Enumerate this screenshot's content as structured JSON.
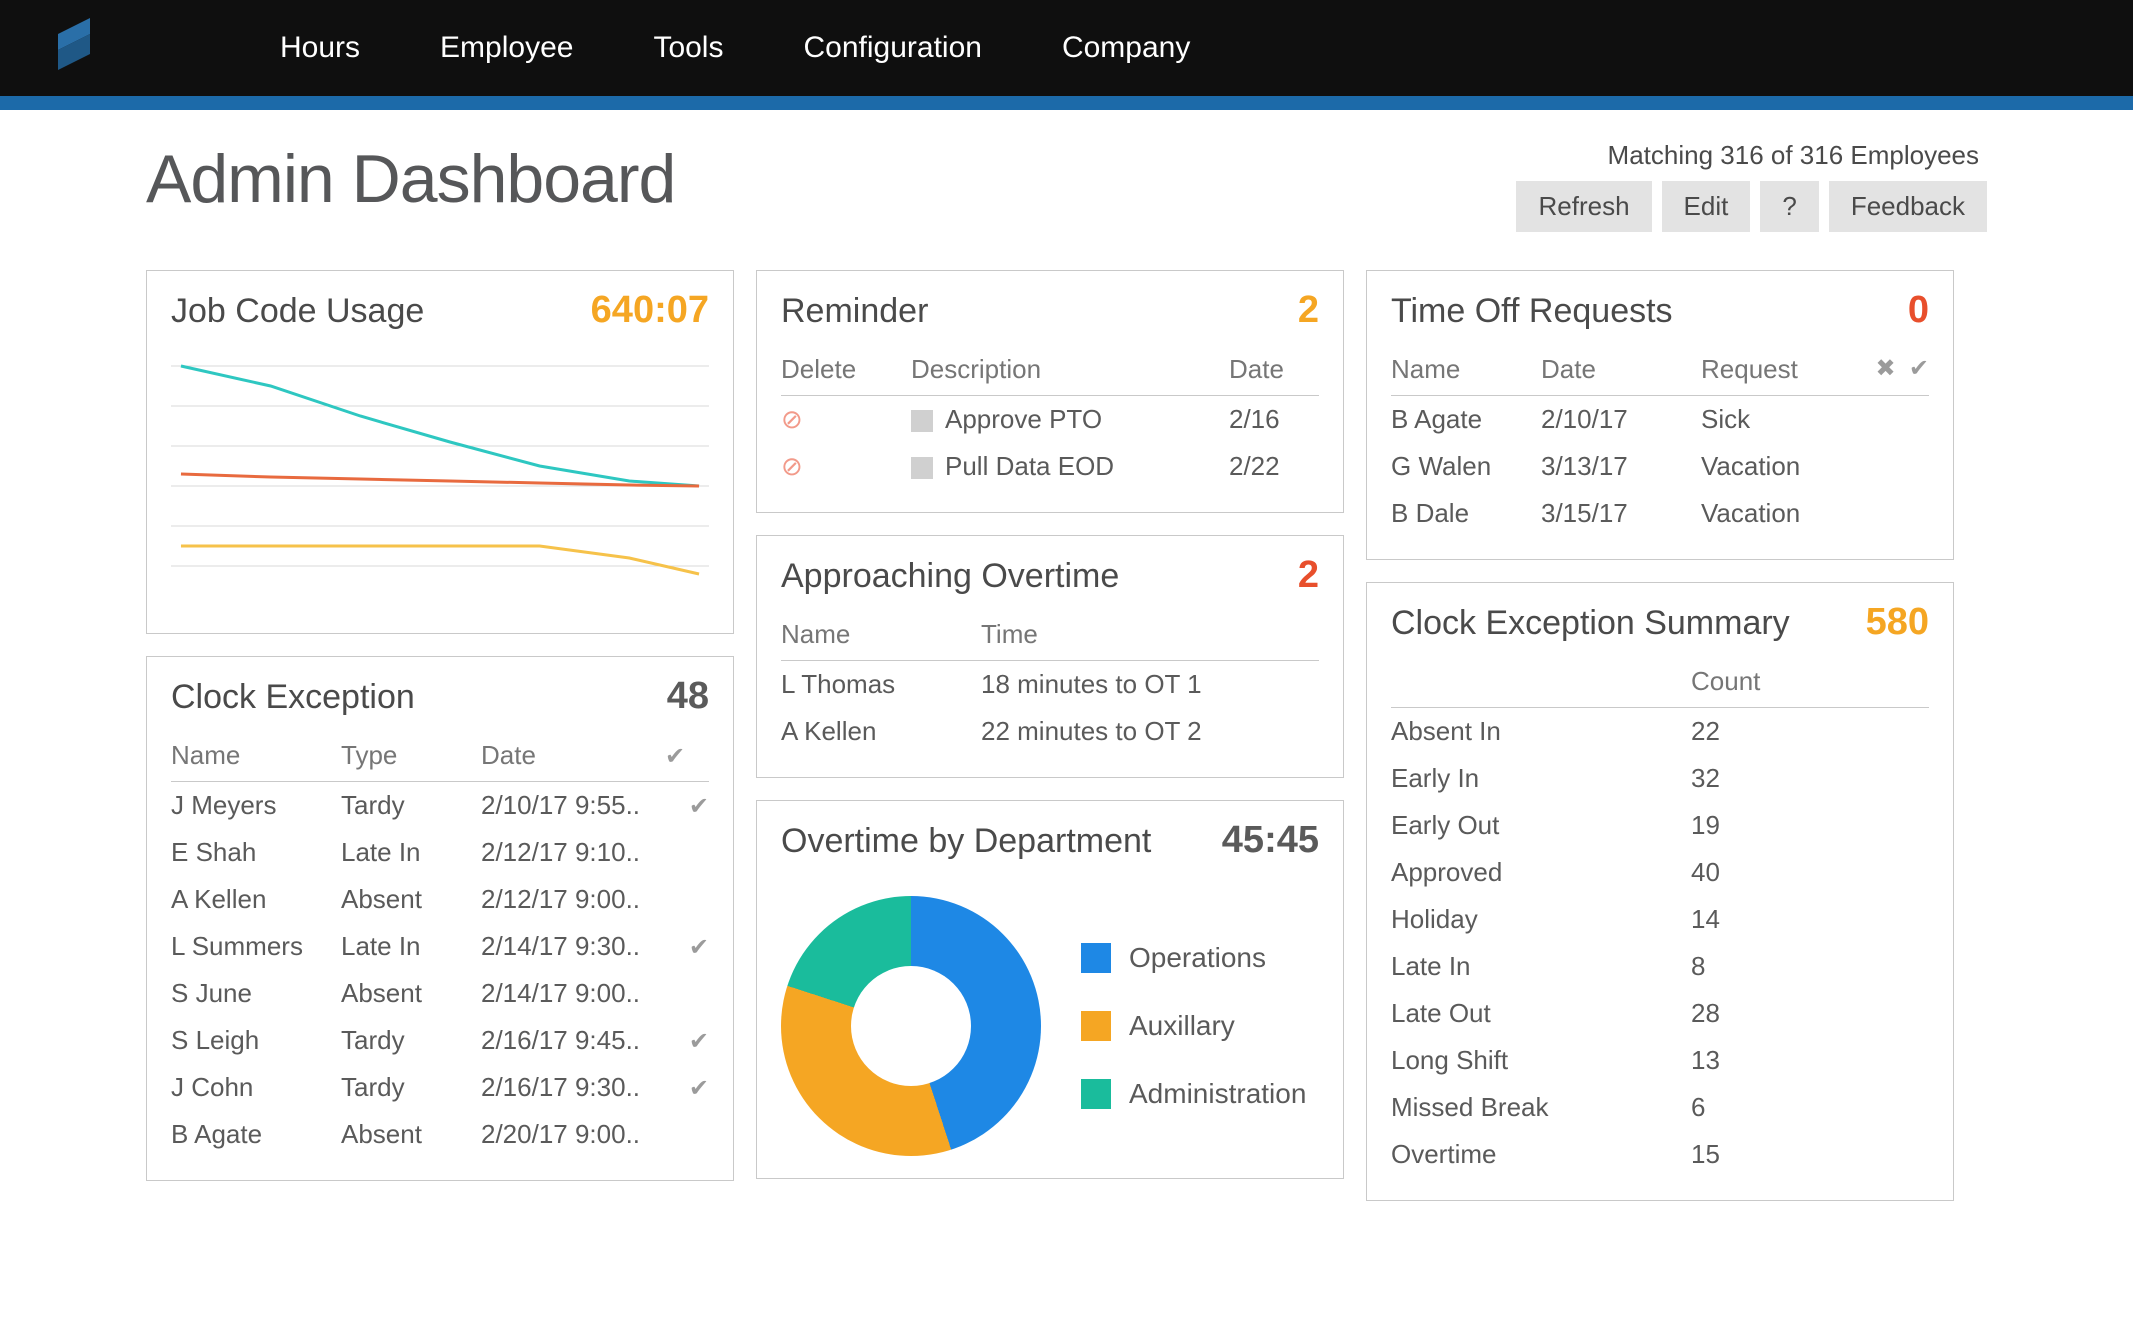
{
  "nav": {
    "items": [
      "Hours",
      "Employee",
      "Tools",
      "Configuration",
      "Company"
    ]
  },
  "header": {
    "page_title": "Admin Dashboard",
    "matching_text": "Matching 316 of 316 Employees",
    "buttons": {
      "refresh": "Refresh",
      "edit": "Edit",
      "help": "?",
      "feedback": "Feedback"
    }
  },
  "job_code_usage": {
    "title": "Job Code Usage",
    "value": "640:07"
  },
  "clock_exception": {
    "title": "Clock Exception",
    "value": "48",
    "headers": {
      "name": "Name",
      "type": "Type",
      "date": "Date"
    },
    "rows": [
      {
        "name": "J Meyers",
        "type": "Tardy",
        "date": "2/10/17 9:55..",
        "checked": true
      },
      {
        "name": "E Shah",
        "type": "Late In",
        "date": "2/12/17 9:10..",
        "checked": false
      },
      {
        "name": "A Kellen",
        "type": "Absent",
        "date": "2/12/17 9:00..",
        "checked": false
      },
      {
        "name": "L Summers",
        "type": "Late In",
        "date": "2/14/17 9:30..",
        "checked": true
      },
      {
        "name": "S June",
        "type": "Absent",
        "date": "2/14/17 9:00..",
        "checked": false
      },
      {
        "name": "S Leigh",
        "type": "Tardy",
        "date": "2/16/17 9:45..",
        "checked": true
      },
      {
        "name": "J Cohn",
        "type": "Tardy",
        "date": "2/16/17 9:30..",
        "checked": true
      },
      {
        "name": "B Agate",
        "type": "Absent",
        "date": "2/20/17 9:00..",
        "checked": false
      }
    ]
  },
  "reminder": {
    "title": "Reminder",
    "value": "2",
    "headers": {
      "delete": "Delete",
      "description": "Description",
      "date": "Date"
    },
    "rows": [
      {
        "description": "Approve PTO",
        "date": "2/16"
      },
      {
        "description": "Pull Data EOD",
        "date": "2/22"
      }
    ]
  },
  "approaching_overtime": {
    "title": "Approaching Overtime",
    "value": "2",
    "headers": {
      "name": "Name",
      "time": "Time"
    },
    "rows": [
      {
        "name": "L Thomas",
        "time": "18 minutes to OT 1"
      },
      {
        "name": "A Kellen",
        "time": "22 minutes to OT 2"
      }
    ]
  },
  "overtime_by_department": {
    "title": "Overtime by Department",
    "value": "45:45",
    "legend": [
      {
        "label": "Operations",
        "color": "#1e88e5"
      },
      {
        "label": "Auxillary",
        "color": "#f5a623"
      },
      {
        "label": "Administration",
        "color": "#1abc9c"
      }
    ]
  },
  "time_off_requests": {
    "title": "Time Off Requests",
    "value": "0",
    "headers": {
      "name": "Name",
      "date": "Date",
      "request": "Request"
    },
    "rows": [
      {
        "name": "B Agate",
        "date": "2/10/17",
        "request": "Sick"
      },
      {
        "name": "G Walen",
        "date": "3/13/17",
        "request": "Vacation"
      },
      {
        "name": "B Dale",
        "date": "3/15/17",
        "request": "Vacation"
      }
    ]
  },
  "clock_exception_summary": {
    "title": "Clock Exception Summary",
    "value": "580",
    "headers": {
      "blank": "",
      "count": "Count"
    },
    "rows": [
      {
        "label": "Absent In",
        "count": "22"
      },
      {
        "label": "Early In",
        "count": "32"
      },
      {
        "label": "Early Out",
        "count": "19"
      },
      {
        "label": "Approved",
        "count": "40"
      },
      {
        "label": "Holiday",
        "count": "14"
      },
      {
        "label": "Late In",
        "count": "8"
      },
      {
        "label": "Late Out",
        "count": "28"
      },
      {
        "label": "Long Shift",
        "count": "13"
      },
      {
        "label": "Missed Break",
        "count": "6"
      },
      {
        "label": "Overtime",
        "count": "15"
      }
    ]
  },
  "chart_data": [
    {
      "type": "line",
      "title": "Job Code Usage",
      "x": [
        0,
        1,
        2,
        3,
        4,
        5,
        6
      ],
      "series": [
        {
          "name": "teal",
          "color": "#2ec7c1",
          "values": [
            100,
            88,
            74,
            62,
            51,
            42,
            40
          ]
        },
        {
          "name": "orange",
          "color": "#e86a3f",
          "values": [
            46,
            44,
            43,
            42,
            41,
            40,
            40
          ]
        },
        {
          "name": "yellow",
          "color": "#f6c24a",
          "values": [
            18,
            18,
            18,
            18,
            18,
            14,
            8
          ]
        }
      ],
      "gridlines_y": [
        0,
        20,
        40,
        60,
        80,
        100
      ]
    },
    {
      "type": "pie",
      "title": "Overtime by Department",
      "categories": [
        "Operations",
        "Auxillary",
        "Administration"
      ],
      "values": [
        45,
        35,
        20
      ],
      "colors": [
        "#1e88e5",
        "#f5a623",
        "#1abc9c"
      ]
    }
  ]
}
